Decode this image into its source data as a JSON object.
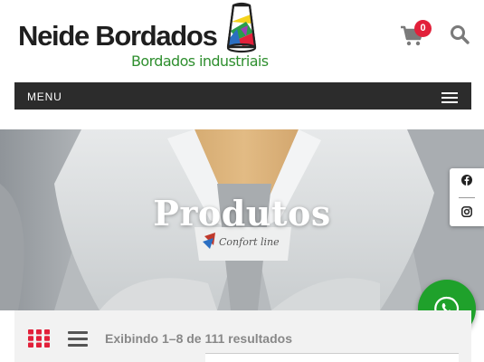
{
  "header": {
    "logo_name": "Neide Bordados",
    "logo_tagline": "Bordados industriais",
    "cart_count": "0",
    "icons": [
      "cart-icon",
      "search-icon"
    ]
  },
  "nav": {
    "menu_label": "MENU"
  },
  "hero": {
    "title": "Produtos",
    "label_text": "Confort line"
  },
  "social": {
    "icons": [
      "facebook-icon",
      "instagram-icon"
    ]
  },
  "shop": {
    "results_text": "Exibindo 1–8 de 111 resultados"
  },
  "colors": {
    "menu_bg": "#2c2c2c",
    "badge": "#e2203a",
    "whatsapp": "#1fa12b",
    "grid_icon": "#e2203a",
    "tagline": "#2f8f2f"
  }
}
